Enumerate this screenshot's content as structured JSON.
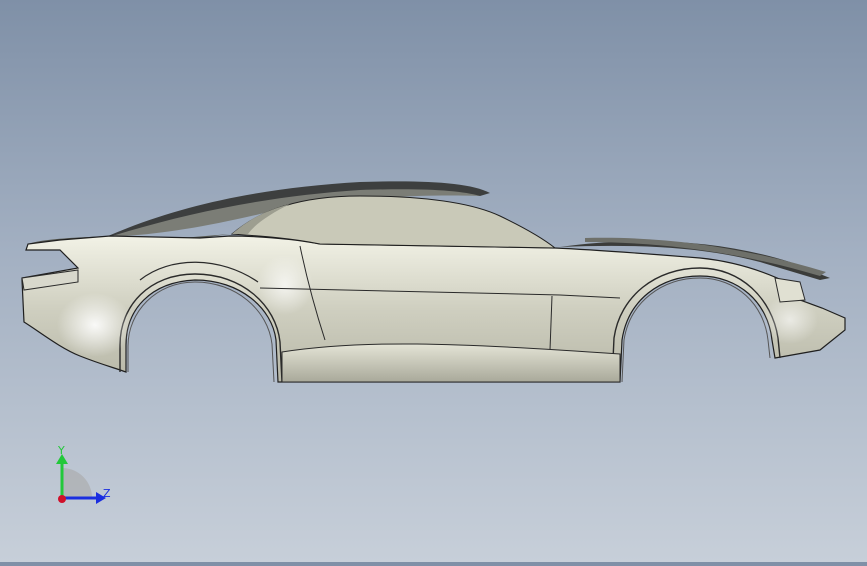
{
  "viewport": {
    "background_top": "#7f90a7",
    "background_bottom": "#c7cfd9",
    "model": "car-body-shell"
  },
  "triad": {
    "y_label": "Y",
    "z_label": "Z",
    "y_color": "#22c83a",
    "z_color": "#1a2ee0",
    "x_color": "#d0102a"
  }
}
